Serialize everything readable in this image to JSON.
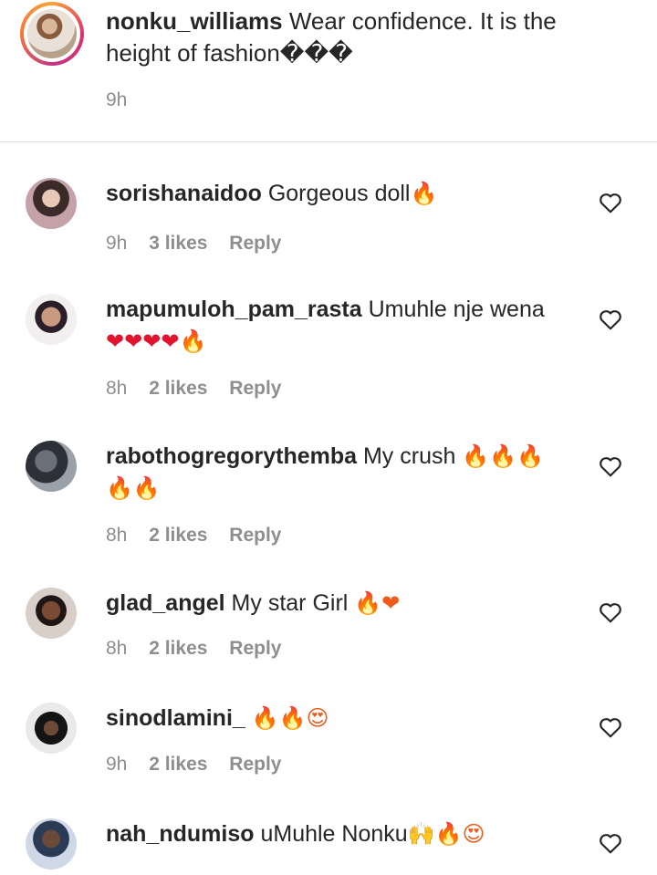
{
  "caption": {
    "username": "nonku_williams",
    "text": "Wear confidence. It is the height of fashion���",
    "time": "9h"
  },
  "comments": [
    {
      "username": "sorishanaidoo",
      "text": "Gorgeous doll",
      "emoji": "🔥",
      "time": "9h",
      "likes": "3 likes",
      "reply": "Reply"
    },
    {
      "username": "mapumuloh_pam_rasta",
      "text": "Umuhle nje wena",
      "emoji": "❤❤❤❤🔥",
      "time": "8h",
      "likes": "2 likes",
      "reply": "Reply"
    },
    {
      "username": "rabothogregorythemba",
      "text": "My crush",
      "emoji": "🔥🔥🔥 🔥🔥",
      "time": "8h",
      "likes": "2 likes",
      "reply": "Reply"
    },
    {
      "username": "glad_angel",
      "text": "My star Girl",
      "emoji": "🔥❤",
      "time": "8h",
      "likes": "2 likes",
      "reply": "Reply"
    },
    {
      "username": "sinodlamini_",
      "text": "",
      "emoji": "🔥🔥😍",
      "time": "9h",
      "likes": "2 likes",
      "reply": "Reply"
    },
    {
      "username": "nah_ndumiso",
      "text": "uMuhle Nonku",
      "emoji": "🙌🔥😍",
      "time": "",
      "likes": "",
      "reply": ""
    }
  ],
  "icons": {
    "like": "heart-outline-icon"
  },
  "colors": {
    "text": "#262626",
    "secondary": "#8e8e8e",
    "divider": "#dbdbdb",
    "fire": "#f05a1a",
    "heart": "#e0152d"
  }
}
